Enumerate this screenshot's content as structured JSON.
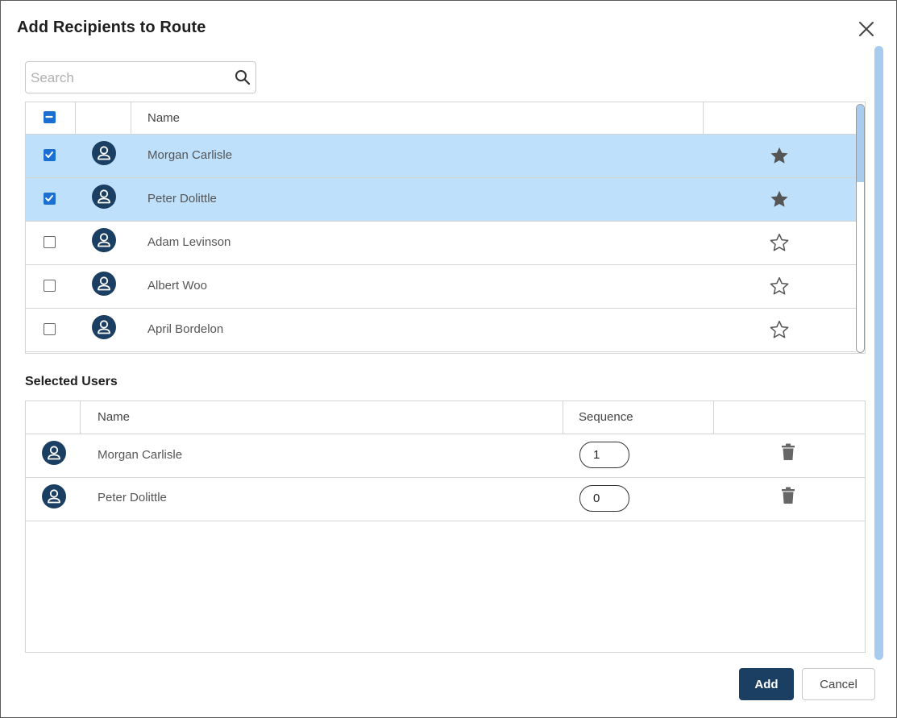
{
  "dialog": {
    "title": "Add Recipients to Route",
    "close_icon": "close-icon"
  },
  "search": {
    "placeholder": "Search",
    "value": "",
    "icon": "search-icon"
  },
  "recipients": {
    "header": {
      "name": "Name",
      "select_all_state": "indeterminate"
    },
    "rows": [
      {
        "name": "Morgan Carlisle",
        "checked": true,
        "favorite": true
      },
      {
        "name": "Peter Dolittle",
        "checked": true,
        "favorite": true
      },
      {
        "name": "Adam Levinson",
        "checked": false,
        "favorite": false
      },
      {
        "name": "Albert Woo",
        "checked": false,
        "favorite": false
      },
      {
        "name": "April Bordelon",
        "checked": false,
        "favorite": false
      }
    ]
  },
  "selected_users": {
    "title": "Selected Users",
    "header": {
      "name": "Name",
      "sequence": "Sequence"
    },
    "rows": [
      {
        "name": "Morgan Carlisle",
        "sequence": "1"
      },
      {
        "name": "Peter Dolittle",
        "sequence": "0"
      }
    ]
  },
  "buttons": {
    "add": "Add",
    "cancel": "Cancel"
  },
  "colors": {
    "selected_row": "#bee0fb",
    "checkbox_accent": "#1a6fd1",
    "avatar": "#1b3f63",
    "primary_button": "#1b3f63",
    "scrollbar": "#a8ccf0"
  }
}
